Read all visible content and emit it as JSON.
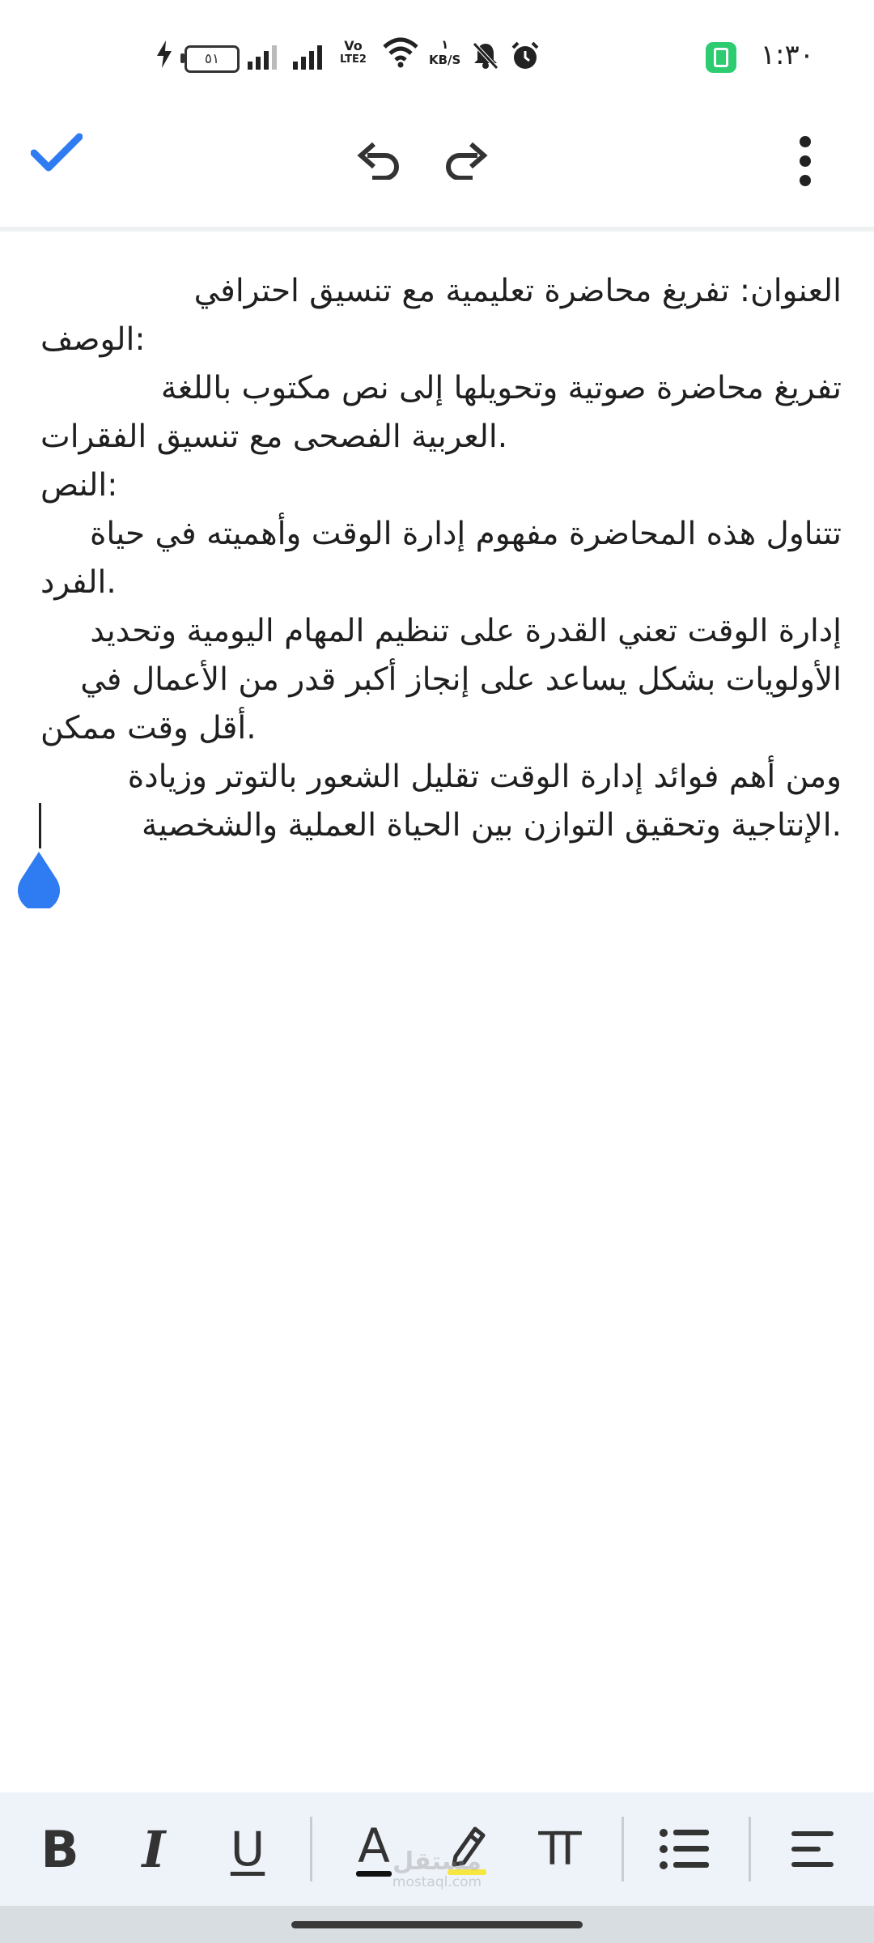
{
  "status_bar": {
    "time": "١:٣٠",
    "battery_level": "٥١",
    "network_label_top": "Vo",
    "network_label_bottom": "LTE2",
    "speed_value": "١",
    "speed_unit": "KB/S",
    "icons": [
      "charging-icon",
      "battery-icon",
      "signal-icon",
      "signal-icon",
      "volte-icon",
      "wifi-icon",
      "data-speed-icon",
      "bell-off-icon",
      "alarm-icon",
      "battery-saver-icon"
    ]
  },
  "toolbar": {
    "icons": [
      "check-icon",
      "undo-icon",
      "redo-icon",
      "more-vert-icon"
    ],
    "accent": "#2f7bf2"
  },
  "document": {
    "lines": [
      "العنوان: تفريغ محاضرة تعليمية مع تنسيق احترافي",
      ":الوصف",
      "تفريغ محاضرة صوتية وتحويلها إلى نص مكتوب باللغة",
      ".العربية الفصحى مع تنسيق الفقرات",
      ":النص",
      "تتناول هذه المحاضرة مفهوم إدارة الوقت وأهميته في حياة",
      ".الفرد",
      "إدارة الوقت تعني القدرة على تنظيم المهام اليومية وتحديد",
      "الأولويات بشكل يساعد على إنجاز أكبر قدر من الأعمال في",
      ".أقل وقت ممكن",
      "ومن أهم فوائد إدارة الوقت تقليل الشعور بالتوتر وزيادة",
      ".الإنتاجية وتحقيق التوازن بين الحياة العملية والشخصية"
    ]
  },
  "format_bar": {
    "bold_label": "B",
    "italic_label": "I",
    "underline_label": "U",
    "text_color_label": "A",
    "text_size_label": "TT",
    "icons": [
      "bold-icon",
      "italic-icon",
      "underline-icon",
      "text-color-icon",
      "highlight-icon",
      "text-size-icon",
      "bulleted-list-icon",
      "align-icon"
    ],
    "highlight_color": "#f5e642"
  },
  "watermark": {
    "arabic": "مستقل",
    "latin": "mostaql.com"
  }
}
